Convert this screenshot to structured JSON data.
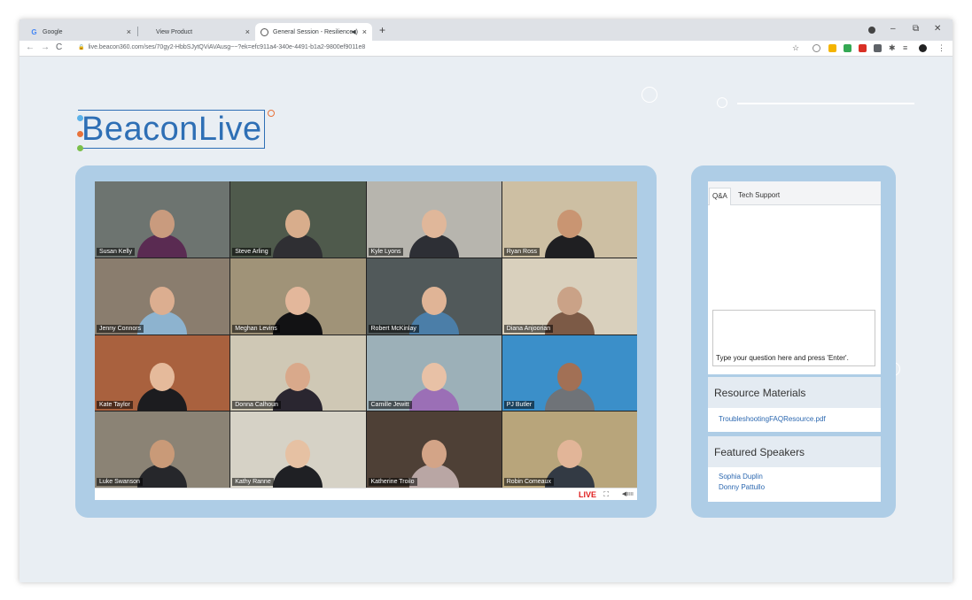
{
  "browser": {
    "tabs": [
      {
        "title": "Google",
        "icon": "google-g-icon"
      },
      {
        "title": "View Product",
        "icon": ""
      },
      {
        "title": "General Session - Resilience",
        "icon": "globe-icon"
      }
    ],
    "url": "live.beacon360.com/ses/70gy2-HbbSJytQViAVAusg~~?ek=efc911a4-340e-4491-b1a2-9800ef9011e8",
    "new_tab_label": "+",
    "close_label": "×"
  },
  "logo": {
    "text": "BeaconLive"
  },
  "video": {
    "participants": [
      {
        "name": "Susan Kelly",
        "bg": "#6d7470",
        "skin": "#c99b7e",
        "shirt": "#5a2b52"
      },
      {
        "name": "Steve Arling",
        "bg": "#4f5a4c",
        "skin": "#d8ad8c",
        "shirt": "#2f2f33"
      },
      {
        "name": "Kyle Lyons",
        "bg": "#b7b5ae",
        "skin": "#e0b79a",
        "shirt": "#2d2f35"
      },
      {
        "name": "Ryan Ross",
        "bg": "#cdbfa3",
        "skin": "#c99572",
        "shirt": "#1f1f22"
      },
      {
        "name": "Jenny Connors",
        "bg": "#8a7d6e",
        "skin": "#dcae90",
        "shirt": "#8db3cf"
      },
      {
        "name": "Meghan Levins",
        "bg": "#a09378",
        "skin": "#e3b79b",
        "shirt": "#121214"
      },
      {
        "name": "Robert McKinlay",
        "bg": "#51595a",
        "skin": "#e0b496",
        "shirt": "#4b7ea8"
      },
      {
        "name": "Diana Anjoorian",
        "bg": "#d9d0bd",
        "skin": "#caa287",
        "shirt": "#7c5a46"
      },
      {
        "name": "Kate Taylor",
        "bg": "#a9613e",
        "skin": "#e5ba9b",
        "shirt": "#1c1c1f"
      },
      {
        "name": "Donna Calhoun",
        "bg": "#cfc8b5",
        "skin": "#d9a98b",
        "shirt": "#2a2630"
      },
      {
        "name": "Camille Jewitt",
        "bg": "#9cb0b8",
        "skin": "#e8c1a6",
        "shirt": "#9b6fb6"
      },
      {
        "name": "PJ Butler",
        "bg": "#3b8fc9",
        "skin": "#a27055",
        "shirt": "#6f7378"
      },
      {
        "name": "Luke Swanson",
        "bg": "#8b8375",
        "skin": "#c99a78",
        "shirt": "#26272b"
      },
      {
        "name": "Kathy Ranne",
        "bg": "#d6d2c6",
        "skin": "#e6c1a3",
        "shirt": "#1f2024"
      },
      {
        "name": "Katherine Troilo",
        "bg": "#4e4036",
        "skin": "#d3a487",
        "shirt": "#b9a6a4"
      },
      {
        "name": "Robin Comeaux",
        "bg": "#b8a57b",
        "skin": "#e2b598",
        "shirt": "#333a44"
      }
    ],
    "live_label": "LIVE",
    "fullscreen_symbol": "⛶",
    "volume_symbol": "◀ıııı"
  },
  "qa": {
    "tabs": [
      "Q&A",
      "Tech Support"
    ],
    "placeholder": "Type your question here and press 'Enter'."
  },
  "resources": {
    "title": "Resource Materials",
    "items": [
      "TroubleshootingFAQResource.pdf"
    ]
  },
  "speakers": {
    "title": "Featured Speakers",
    "items": [
      "Sophia Duplin",
      "Donny Pattullo"
    ]
  },
  "colors": {
    "brand": "#2e6fb5",
    "panel": "#aecde6",
    "page_bg": "#e9eef3",
    "live": "#e02020",
    "link": "#2c68b0"
  }
}
